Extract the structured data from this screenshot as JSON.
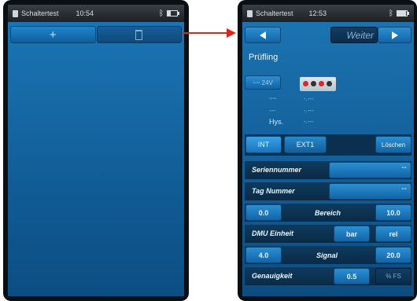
{
  "left_screen": {
    "status": {
      "title": "Schaltertest",
      "time": "10:54",
      "battery_level": 0.3
    },
    "toolbar": {
      "add_label": "+",
      "delete_icon": "trash-icon"
    }
  },
  "right_screen": {
    "status": {
      "title": "Schaltertest",
      "time": "12:53",
      "battery_level": 0.9
    },
    "nav": {
      "next_label": "Weiter"
    },
    "section_title": "Prüfling",
    "device": {
      "voltage_button": "~~ 24V",
      "rows": [
        {
          "symbol": "~~",
          "value": "-.---"
        },
        {
          "symbol": "---",
          "value": "-.---"
        },
        {
          "symbol": "Hys.",
          "value": "-.---"
        }
      ]
    },
    "tabs": {
      "int": "INT",
      "ext": "EXT1",
      "delete": "Löschen"
    },
    "form": {
      "serial_label": "Seriennummer",
      "serial_value": "--",
      "tag_label": "Tag Nummer",
      "tag_value": "--",
      "range_label": "Bereich",
      "range_min": "0.0",
      "range_max": "10.0",
      "dmu_label": "DMU Einheit",
      "dmu_unit": "bar",
      "dmu_rel": "rel",
      "signal_label": "Signal",
      "signal_min": "4.0",
      "signal_max": "20.0",
      "accuracy_label": "Genauigkeit",
      "accuracy_value": "0.5",
      "accuracy_unit": "% FS"
    }
  },
  "colors": {
    "arrow": "#e2231a",
    "accent": "#1b74b3"
  }
}
